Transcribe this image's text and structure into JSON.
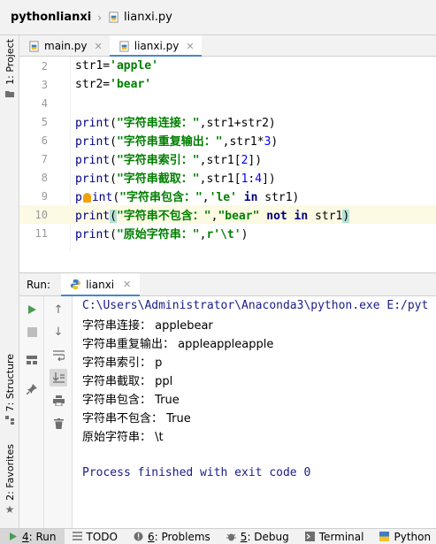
{
  "breadcrumb": {
    "project": "pythonlianxi",
    "file": "lianxi.py"
  },
  "left_stripe": {
    "project_tab": "1: Project",
    "structure_tab": "7: Structure",
    "favorites_tab": "2: Favorites"
  },
  "editor_tabs": [
    {
      "label": "main.py",
      "active": false
    },
    {
      "label": "lianxi.py",
      "active": true
    }
  ],
  "editor": {
    "lines": [
      {
        "num": "2",
        "text": "str1='apple'"
      },
      {
        "num": "3",
        "text": "str2='bear'"
      },
      {
        "num": "4",
        "text": ""
      },
      {
        "num": "5",
        "text": "print(\"字符串连接：\",str1+str2)"
      },
      {
        "num": "6",
        "text": "print(\"字符串重复输出：\",str1*3)"
      },
      {
        "num": "7",
        "text": "print(\"字符串索引：\",str1[2])"
      },
      {
        "num": "8",
        "text": "print(\"字符串截取：\",str1[1:4])"
      },
      {
        "num": "9",
        "text": "print(\"字符串包含：\",'le' in str1)"
      },
      {
        "num": "10",
        "text": "print(\"字符串不包含：\",\"bear\" not in str1)"
      },
      {
        "num": "11",
        "text": "print(\"原始字符串：\",r'\\t')"
      }
    ],
    "current_line": "10"
  },
  "run_panel": {
    "label": "Run:",
    "tab_label": "lianxi",
    "console": {
      "command": "C:\\Users\\Administrator\\Anaconda3\\python.exe E:/pyt",
      "output": [
        "字符串连接： applebear",
        "字符串重复输出： appleappleapple",
        "字符串索引： p",
        "字符串截取： ppl",
        "字符串包含： True",
        "字符串不包含： True",
        "原始字符串： \\t"
      ],
      "exit_message": "Process finished with exit code 0"
    }
  },
  "status_bar": {
    "items": [
      {
        "key": "4",
        "label": "Run",
        "icon": "run-icon",
        "active": true
      },
      {
        "key": "",
        "label": "TODO",
        "icon": "todo-icon",
        "active": false
      },
      {
        "key": "6",
        "label": "Problems",
        "icon": "problems-icon",
        "active": false
      },
      {
        "key": "5",
        "label": "Debug",
        "icon": "debug-icon",
        "active": false
      },
      {
        "key": "",
        "label": "Terminal",
        "icon": "terminal-icon",
        "active": false
      },
      {
        "key": "",
        "label": "Python",
        "icon": "python-console-icon",
        "active": false
      }
    ]
  },
  "colors": {
    "keyword": "#000080",
    "string": "#008000",
    "number": "#0000ff",
    "console_path": "#1b1b8a",
    "accent": "#4a86c7",
    "current_line": "#fcfae3",
    "run_green": "#499c54"
  }
}
